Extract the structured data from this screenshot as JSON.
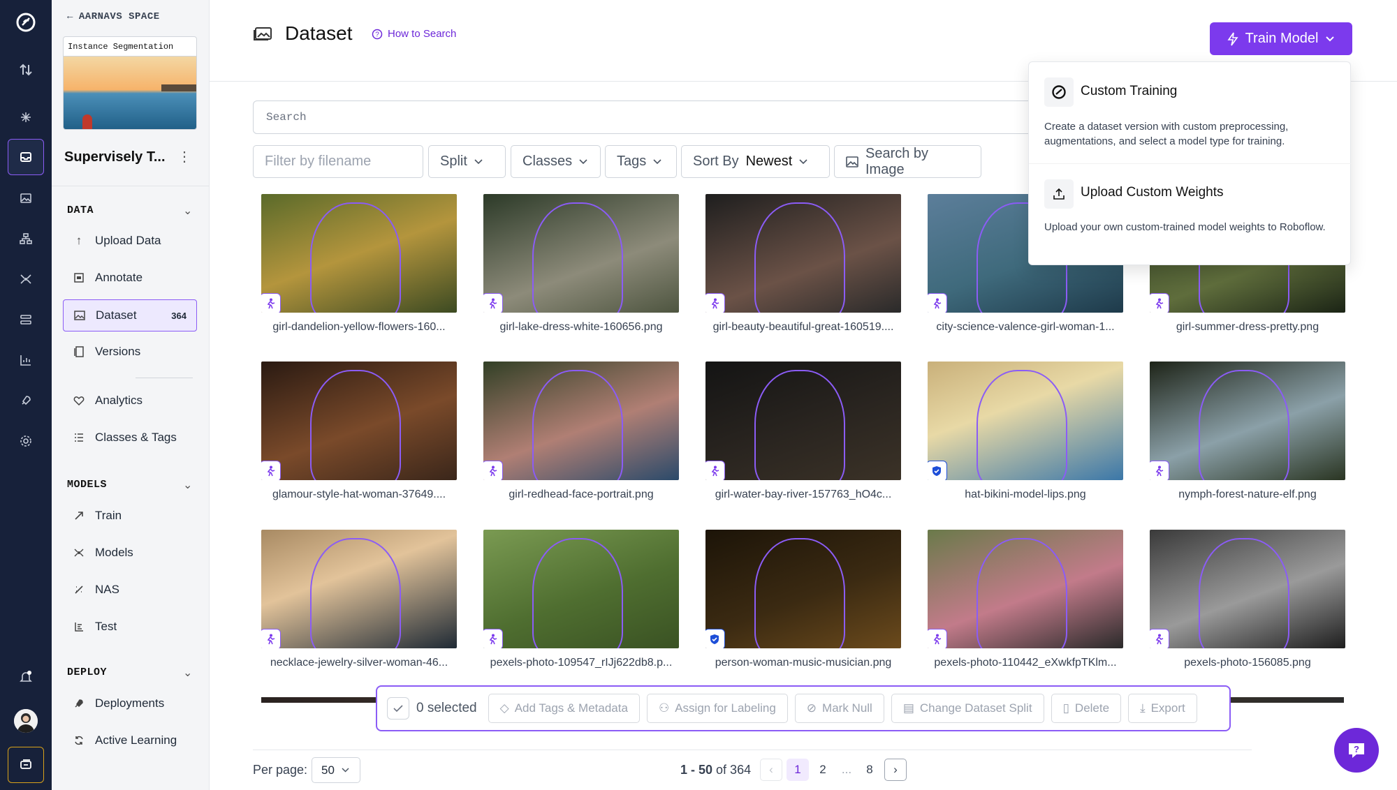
{
  "sidebar": {
    "back_label": "AARNAVS SPACE",
    "project_thumb_label": "Instance Segmentation",
    "project_name": "Supervisely T...",
    "sections": {
      "data": "DATA",
      "models": "MODELS",
      "deploy": "DEPLOY"
    },
    "data_items": [
      {
        "label": "Upload Data",
        "icon": "upload-icon"
      },
      {
        "label": "Annotate",
        "icon": "annotate-icon"
      },
      {
        "label": "Dataset",
        "icon": "image-icon",
        "count": "364",
        "active": true
      },
      {
        "label": "Versions",
        "icon": "versions-icon"
      },
      {
        "label": "Analytics",
        "icon": "analytics-icon"
      },
      {
        "label": "Classes & Tags",
        "icon": "list-icon"
      }
    ],
    "model_items": [
      {
        "label": "Train",
        "icon": "train-icon"
      },
      {
        "label": "Models",
        "icon": "models-icon"
      },
      {
        "label": "NAS",
        "icon": "nas-icon"
      },
      {
        "label": "Test",
        "icon": "test-icon"
      }
    ],
    "deploy_items": [
      {
        "label": "Deployments",
        "icon": "rocket-icon"
      },
      {
        "label": "Active Learning",
        "icon": "refresh-icon"
      }
    ]
  },
  "header": {
    "title": "Dataset",
    "how_to_search": "How to Search",
    "train_button": "Train Model"
  },
  "train_menu": {
    "items": [
      {
        "title": "Custom Training",
        "desc": "Create a dataset version with custom preprocessing, augmentations, and select a model type for training."
      },
      {
        "title": "Upload Custom Weights",
        "desc": "Upload your own custom-trained model weights to Roboflow."
      }
    ]
  },
  "search": {
    "placeholder": "Search"
  },
  "filters": {
    "filename_placeholder": "Filter by filename",
    "split": "Split",
    "classes": "Classes",
    "tags": "Tags",
    "sort_by": "Sort By",
    "sort_value": "Newest",
    "search_by_image": "Search by Image"
  },
  "images": [
    {
      "name": "girl-dandelion-yellow-flowers-160...",
      "badge": "person-icon"
    },
    {
      "name": "girl-lake-dress-white-160656.png",
      "badge": "person-icon"
    },
    {
      "name": "girl-beauty-beautiful-great-160519....",
      "badge": "person-icon"
    },
    {
      "name": "city-science-valence-girl-woman-1...",
      "badge": "person-icon"
    },
    {
      "name": "girl-summer-dress-pretty.png",
      "badge": "person-icon"
    },
    {
      "name": "glamour-style-hat-woman-37649....",
      "badge": "person-icon"
    },
    {
      "name": "girl-redhead-face-portrait.png",
      "badge": "person-icon"
    },
    {
      "name": "girl-water-bay-river-157763_hO4c...",
      "badge": "person-icon"
    },
    {
      "name": "hat-bikini-model-lips.png",
      "badge": "shield-check-icon"
    },
    {
      "name": "nymph-forest-nature-elf.png",
      "badge": "person-icon"
    },
    {
      "name": "necklace-jewelry-silver-woman-46...",
      "badge": "person-icon"
    },
    {
      "name": "pexels-photo-109547_rIJj622db8.p...",
      "badge": "person-icon"
    },
    {
      "name": "person-woman-music-musician.png",
      "badge": "shield-check-icon"
    },
    {
      "name": "pexels-photo-110442_eXwkfpTKlm...",
      "badge": "person-icon"
    },
    {
      "name": "pexels-photo-156085.png",
      "badge": "person-icon"
    }
  ],
  "bulk_bar": {
    "selected": "0 selected",
    "actions": [
      "Add Tags & Metadata",
      "Assign for Labeling",
      "Mark Null",
      "Change Dataset Split",
      "Delete",
      "Export"
    ]
  },
  "pagination": {
    "per_page_label": "Per page:",
    "per_page_value": "50",
    "range": "1 - 50",
    "of_total": "of 364",
    "pages": [
      "1",
      "2",
      "...",
      "8"
    ],
    "current_page": "1"
  },
  "colors": {
    "accent": "#7c3aed",
    "rail_bg": "#17213a"
  }
}
